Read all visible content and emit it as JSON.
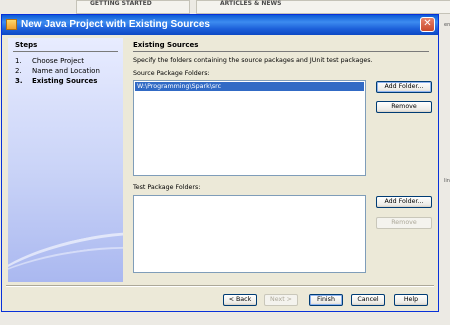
{
  "background": {
    "getting_started": "GETTING STARTED",
    "articles_news": "ARTICLES & NEWS",
    "side_fragments": [
      "ens.",
      "ling"
    ]
  },
  "dialog": {
    "title": "New Java Project with Existing Sources",
    "close_glyph": "✕"
  },
  "steps": {
    "heading": "Steps",
    "items": [
      {
        "num": "1.",
        "label": "Choose Project"
      },
      {
        "num": "2.",
        "label": "Name and Location"
      },
      {
        "num": "3.",
        "label": "Existing Sources",
        "current": true
      }
    ]
  },
  "content": {
    "heading": "Existing Sources",
    "description": "Specify the folders containing the source packages and JUnit test packages.",
    "source_label": "Source Package Folders:",
    "source_items": [
      "W:\\Programming\\Spark\\src"
    ],
    "test_label": "Test Package Folders:",
    "test_items": [],
    "add_folder": "Add Folder...",
    "remove": "Remove"
  },
  "footer": {
    "back": "< Back",
    "next": "Next >",
    "finish": "Finish",
    "cancel": "Cancel",
    "help": "Help"
  },
  "colors": {
    "title_bar": "#0a5ad6",
    "selection": "#316ac5",
    "steps_panel": "#c9d3f7"
  }
}
